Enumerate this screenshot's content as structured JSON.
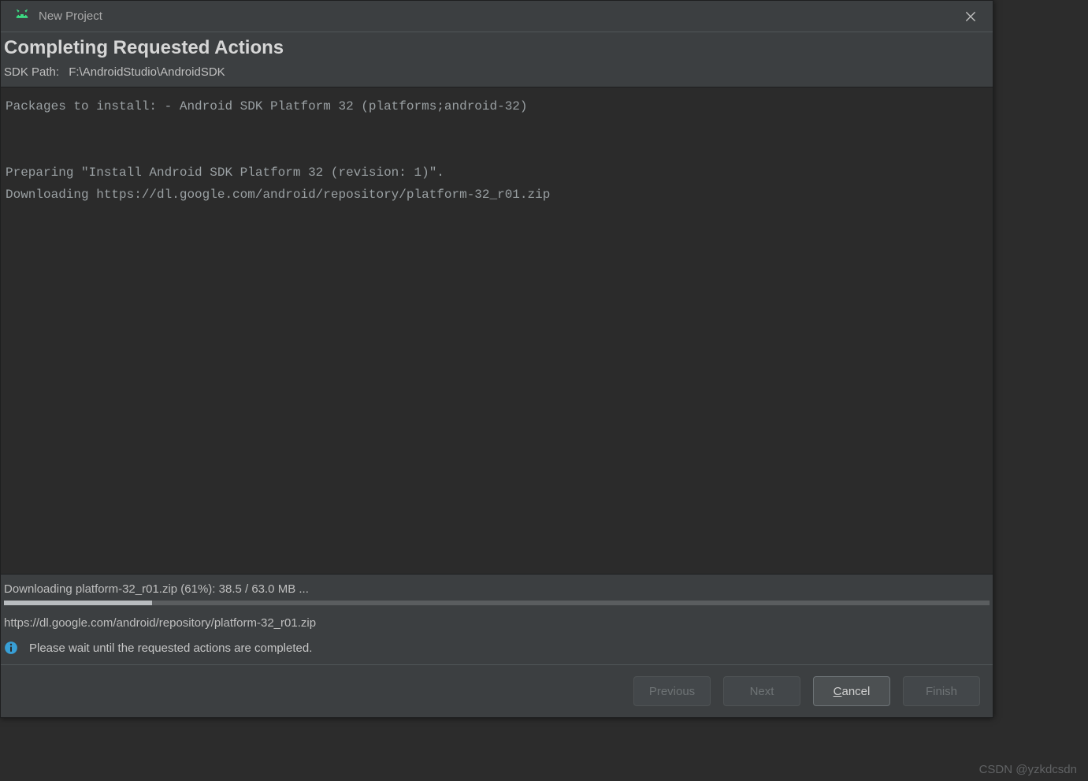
{
  "titlebar": {
    "title": "New Project",
    "close_tooltip": "Close"
  },
  "heading": "Completing Requested Actions",
  "sdk": {
    "label": "SDK Path:",
    "path": "F:\\AndroidStudio\\AndroidSDK"
  },
  "log": {
    "line1": "Packages to install: - Android SDK Platform 32 (platforms;android-32)",
    "line2": "",
    "line3": "",
    "line4": "Preparing \"Install Android SDK Platform 32 (revision: 1)\".",
    "line5": "Downloading https://dl.google.com/android/repository/platform-32_r01.zip"
  },
  "progress": {
    "status_text": "Downloading platform-32_r01.zip (61%): 38.5 / 63.0 MB ...",
    "percent": 15,
    "url": "https://dl.google.com/android/repository/platform-32_r01.zip"
  },
  "info": {
    "message": "Please wait until the requested actions are completed."
  },
  "buttons": {
    "previous": "Previous",
    "next": "Next",
    "cancel_pre": "",
    "cancel_mnemonic": "C",
    "cancel_post": "ancel",
    "finish": "Finish"
  },
  "watermark": "CSDN @yzkdcsdn",
  "colors": {
    "accent_green": "#3ddc84",
    "info_blue": "#389fd6"
  }
}
